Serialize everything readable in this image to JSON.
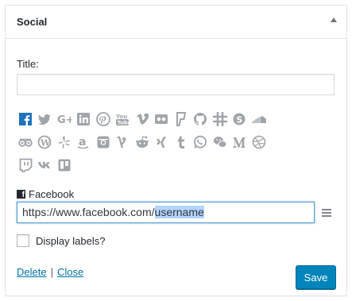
{
  "widget": {
    "title": "Social"
  },
  "form": {
    "title_label": "Title:",
    "title_value": "",
    "network_label": "Facebook",
    "url_prefix": "https://www.facebook.com/",
    "url_selected": "username",
    "display_labels_text": "Display labels?",
    "display_labels_checked": false
  },
  "icons": {
    "active_color": "#1e73be",
    "inactive_color": "#a0a5aa",
    "rows": [
      [
        "facebook",
        "twitter",
        "google-plus",
        "linkedin",
        "pinterest",
        "youtube",
        "vimeo",
        "flickr",
        "foursquare",
        "github",
        "slack",
        "skype",
        "soundcloud"
      ],
      [
        "tripadvisor",
        "wordpress",
        "yelp",
        "amazon",
        "instagram",
        "vine",
        "reddit",
        "xing",
        "tumblr",
        "whatsapp",
        "wechat",
        "medium",
        "dribbble"
      ],
      [
        "twitch",
        "vk",
        "trello"
      ]
    ]
  },
  "actions": {
    "delete_label": "Delete",
    "separator": "|",
    "close_label": "Close",
    "save_label": "Save"
  },
  "colors": {
    "link": "#0073aa",
    "primary_button": "#0085ba"
  }
}
